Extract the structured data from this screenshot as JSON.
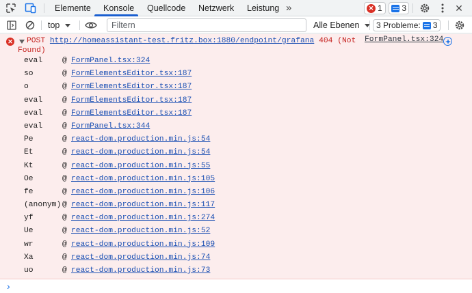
{
  "tabs": [
    {
      "label": "Elemente",
      "active": false
    },
    {
      "label": "Konsole",
      "active": true
    },
    {
      "label": "Quellcode",
      "active": false
    },
    {
      "label": "Netzwerk",
      "active": false
    },
    {
      "label": "Leistung",
      "active": false
    }
  ],
  "tabbar": {
    "more_tabs": "»",
    "errors_count": "1",
    "messages_count": "3",
    "close": "✕"
  },
  "toolbar": {
    "context": "top",
    "filter_placeholder": "Filtern",
    "filter_value": "",
    "levels": "Alle Ebenen",
    "problems_label": "3 Probleme:",
    "problems_count": "3"
  },
  "error": {
    "method": "POST",
    "url": "http://homeassistant-test.fritz.box:1880/endpoint/grafana",
    "status_line1": "404 (Not",
    "status_line2": "Found)",
    "source": "FormPanel.tsx:324"
  },
  "stack": [
    {
      "fn": "eval",
      "at": "@",
      "loc": "FormPanel.tsx:324"
    },
    {
      "fn": "so",
      "at": "@",
      "loc": "FormElementsEditor.tsx:187"
    },
    {
      "fn": "o",
      "at": "@",
      "loc": "FormElementsEditor.tsx:187"
    },
    {
      "fn": "eval",
      "at": "@",
      "loc": "FormElementsEditor.tsx:187"
    },
    {
      "fn": "eval",
      "at": "@",
      "loc": "FormElementsEditor.tsx:187"
    },
    {
      "fn": "eval",
      "at": "@",
      "loc": "FormPanel.tsx:344"
    },
    {
      "fn": "Pe",
      "at": "@",
      "loc": "react-dom.production.min.js:54"
    },
    {
      "fn": "Et",
      "at": "@",
      "loc": "react-dom.production.min.js:54"
    },
    {
      "fn": "Kt",
      "at": "@",
      "loc": "react-dom.production.min.js:55"
    },
    {
      "fn": "Oe",
      "at": "@",
      "loc": "react-dom.production.min.js:105"
    },
    {
      "fn": "fe",
      "at": "@",
      "loc": "react-dom.production.min.js:106"
    },
    {
      "fn": "(anonym)",
      "at": "@",
      "loc": "react-dom.production.min.js:117"
    },
    {
      "fn": "yf",
      "at": "@",
      "loc": "react-dom.production.min.js:274"
    },
    {
      "fn": "Ue",
      "at": "@",
      "loc": "react-dom.production.min.js:52"
    },
    {
      "fn": "wr",
      "at": "@",
      "loc": "react-dom.production.min.js:109"
    },
    {
      "fn": "Xa",
      "at": "@",
      "loc": "react-dom.production.min.js:74"
    },
    {
      "fn": "uo",
      "at": "@",
      "loc": "react-dom.production.min.js:73"
    }
  ],
  "prompt_symbol": "›",
  "colors": {
    "error_background": "#fceded",
    "error_text": "#c5221f",
    "link": "#1a4fb3",
    "accent": "#1a73e8"
  }
}
